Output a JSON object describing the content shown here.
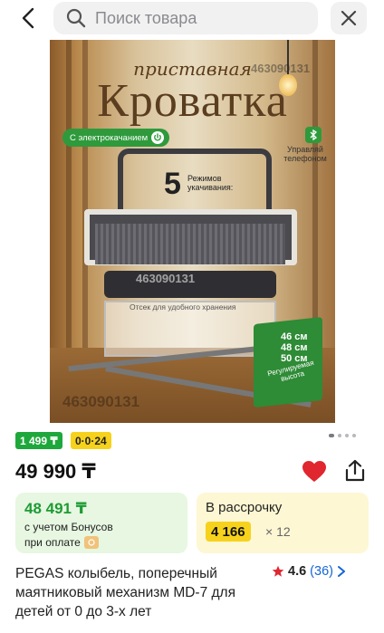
{
  "search": {
    "placeholder": "Поиск товара"
  },
  "image": {
    "subtitle": "приставная",
    "title": "Кроватка",
    "feature_electric": "С электрокачанием",
    "feature_phone": "Управляй телефоном",
    "modes_number": "5",
    "modes_text_1": "Режимов",
    "modes_text_2": "укачивания:",
    "storage_text": "Отсек для удобного хранения",
    "heights": [
      "46 см",
      "48 см",
      "50 см"
    ],
    "height_label": "Регулируемая высота",
    "watermark_top": "463090131",
    "watermark_mid": "463090131",
    "watermark_bottom": "463090131"
  },
  "gallery": {
    "dots_count": 4,
    "active_index": 0
  },
  "badges": {
    "discount_price": "1 499 ₸",
    "installment": "0·0·24"
  },
  "price": "49 990 ₸",
  "bonus_card": {
    "amount": "48 491 ₸",
    "line1": "с учетом Бонусов",
    "line2": "при оплате"
  },
  "installment_card": {
    "label": "В рассрочку",
    "monthly": "4 166",
    "times": "× 12"
  },
  "product": {
    "title": "PEGAS колыбель, поперечный маятниковый механизм MD-7 для детей от 0 до 3-х лет",
    "rating": "4.6",
    "reviews": "(36)"
  },
  "colors": {
    "accent_green": "#1ea83c",
    "accent_yellow": "#f6d21c",
    "favorite_red": "#e0262e",
    "link_blue": "#1565d8"
  },
  "icons": [
    "back-arrow-icon",
    "search-icon",
    "close-icon",
    "heart-icon",
    "share-icon",
    "star-icon",
    "chevron-right-icon",
    "bluetooth-icon",
    "power-icon",
    "coin-icon"
  ]
}
